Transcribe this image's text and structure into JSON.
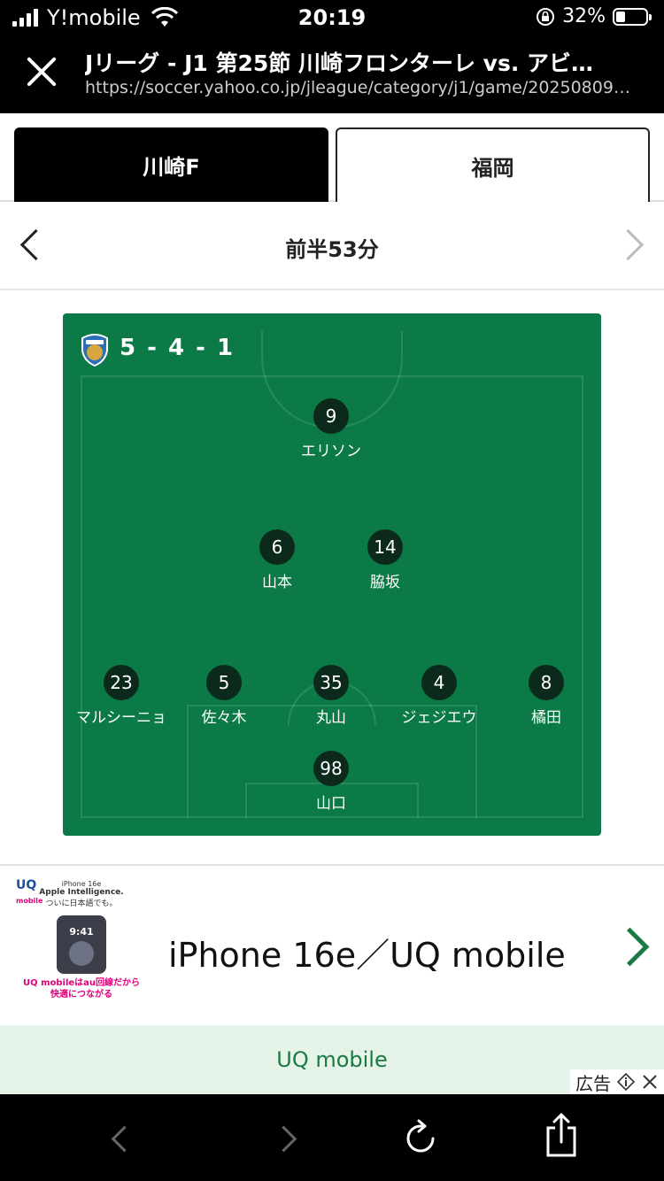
{
  "status": {
    "carrier": "Y!mobile",
    "time": "20:19",
    "battery": "32%"
  },
  "browser": {
    "title": "Jリーグ - J1 第25節 川崎フロンターレ vs. アビ…",
    "url": "https://soccer.yahoo.co.jp/jleague/category/j1/game/20250809…"
  },
  "tabs": {
    "home": "川崎F",
    "away": "福岡"
  },
  "timeline": {
    "label": "前半53分"
  },
  "lineup": {
    "formation": "5 - 4 - 1",
    "players": {
      "fw": {
        "number": "9",
        "name": "エリソン"
      },
      "mf_left": {
        "number": "6",
        "name": "山本"
      },
      "mf_right": {
        "number": "14",
        "name": "脇坂"
      },
      "df1": {
        "number": "23",
        "name": "マルシーニョ"
      },
      "df2": {
        "number": "5",
        "name": "佐々木"
      },
      "df3": {
        "number": "35",
        "name": "丸山"
      },
      "df4": {
        "number": "4",
        "name": "ジェジエウ"
      },
      "df5": {
        "number": "8",
        "name": "橘田"
      },
      "gk": {
        "number": "98",
        "name": "山口"
      }
    }
  },
  "ad": {
    "logo": "UQ",
    "logo_sub": "mobile",
    "thumb_line1": "iPhone 16e",
    "thumb_line2": "Apple Intelligence.",
    "thumb_line3": "ついに日本語でも。",
    "thumb_time": "9:41",
    "thumb_copy1": "UQ mobileはau回線だから",
    "thumb_copy2": "快適につながる",
    "title": "iPhone 16e／UQ mobile",
    "cta": "UQ mobile",
    "tag": "広告"
  },
  "colors": {
    "pitch": "#0b7a47",
    "accent": "#1a7a42"
  }
}
